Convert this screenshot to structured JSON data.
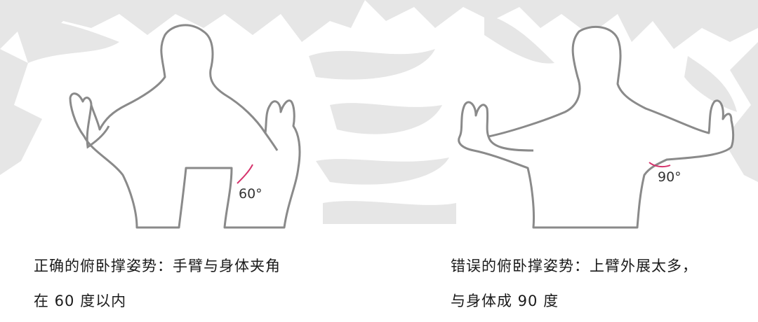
{
  "panels": [
    {
      "angle_label": "60°",
      "caption_lines": [
        "正确的俯卧撑姿势：手臂与身体夹角",
        "在 60 度以内"
      ]
    },
    {
      "angle_label": "90°",
      "caption_lines": [
        "错误的俯卧撑姿势：上臂外展太多，",
        "与身体成 90 度"
      ]
    }
  ],
  "colors": {
    "outline": "#8a8a8a",
    "angle_arc": "#d6336c",
    "brush_background": "#e6e6e6",
    "caption_text": "#1a1a1a"
  }
}
